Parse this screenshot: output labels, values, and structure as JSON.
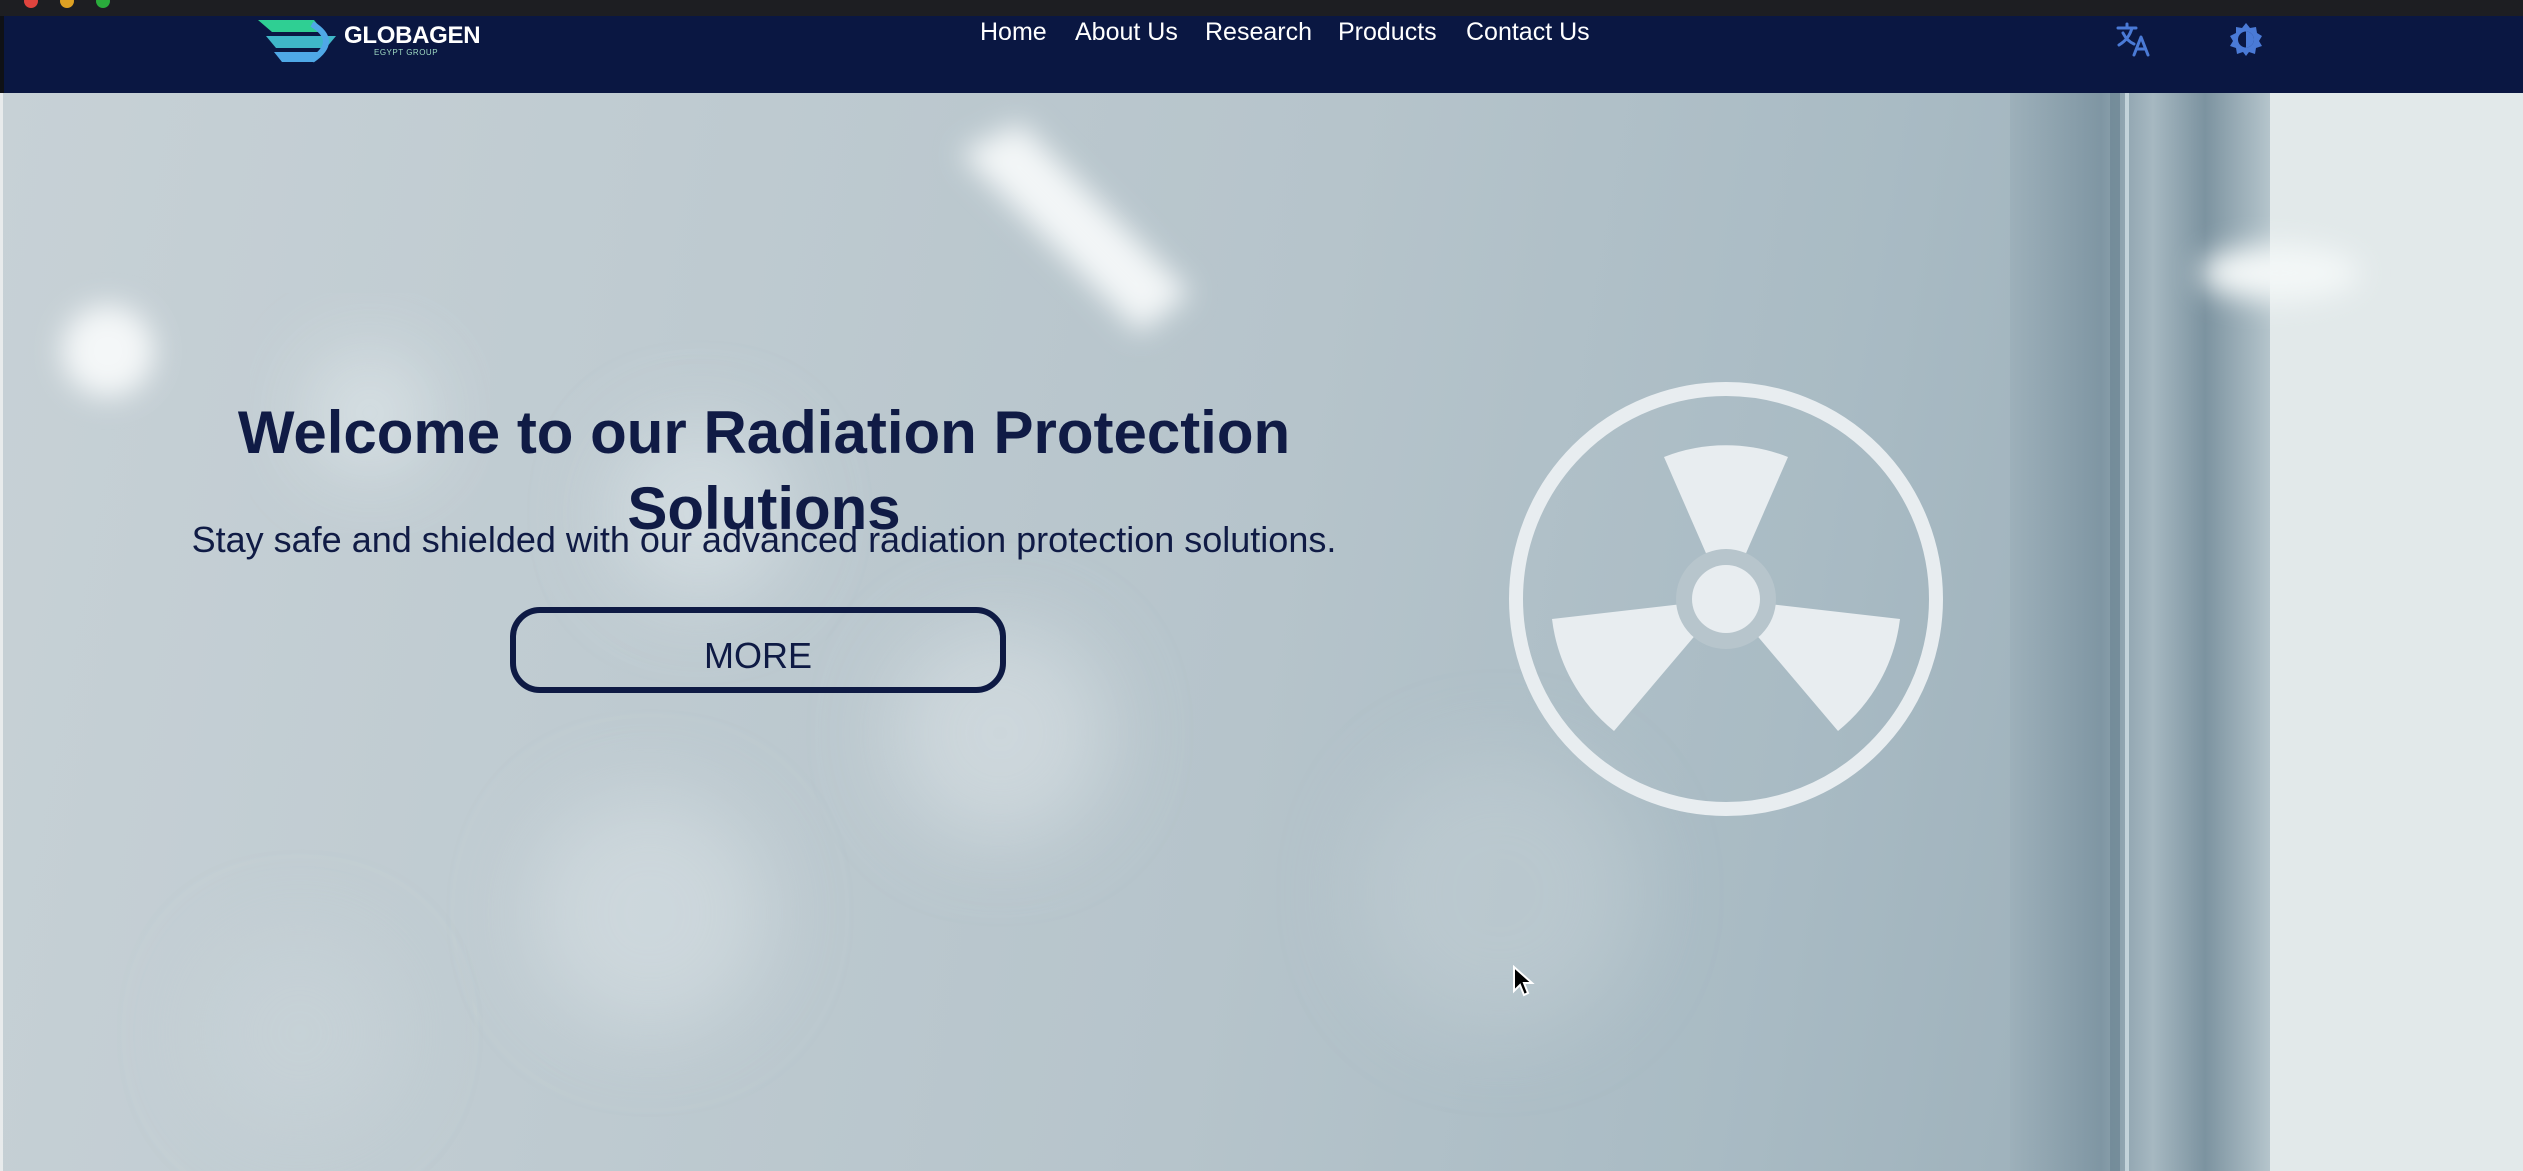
{
  "brand": {
    "name": "GLOBAGEN",
    "tagline": "EGYPT GROUP",
    "logo_colors": [
      "#2fcf93",
      "#4fa8e6"
    ]
  },
  "nav": {
    "links": [
      "Home",
      "About Us",
      "Research",
      "Products",
      "Contact Us"
    ],
    "icons": {
      "language": "translate-icon",
      "theme": "theme-toggle-icon"
    },
    "background": "#0a1742",
    "icon_color": "#4a7ad6"
  },
  "hero": {
    "title": "Welcome to our Radiation Protection Solutions",
    "subtitle": "Stay safe and shielded with our advanced radiation protection solutions.",
    "cta_label": "MORE",
    "symbol": "radiation-trefoil-icon",
    "text_color": "#101b45"
  },
  "pointer": "mouse-cursor-icon"
}
